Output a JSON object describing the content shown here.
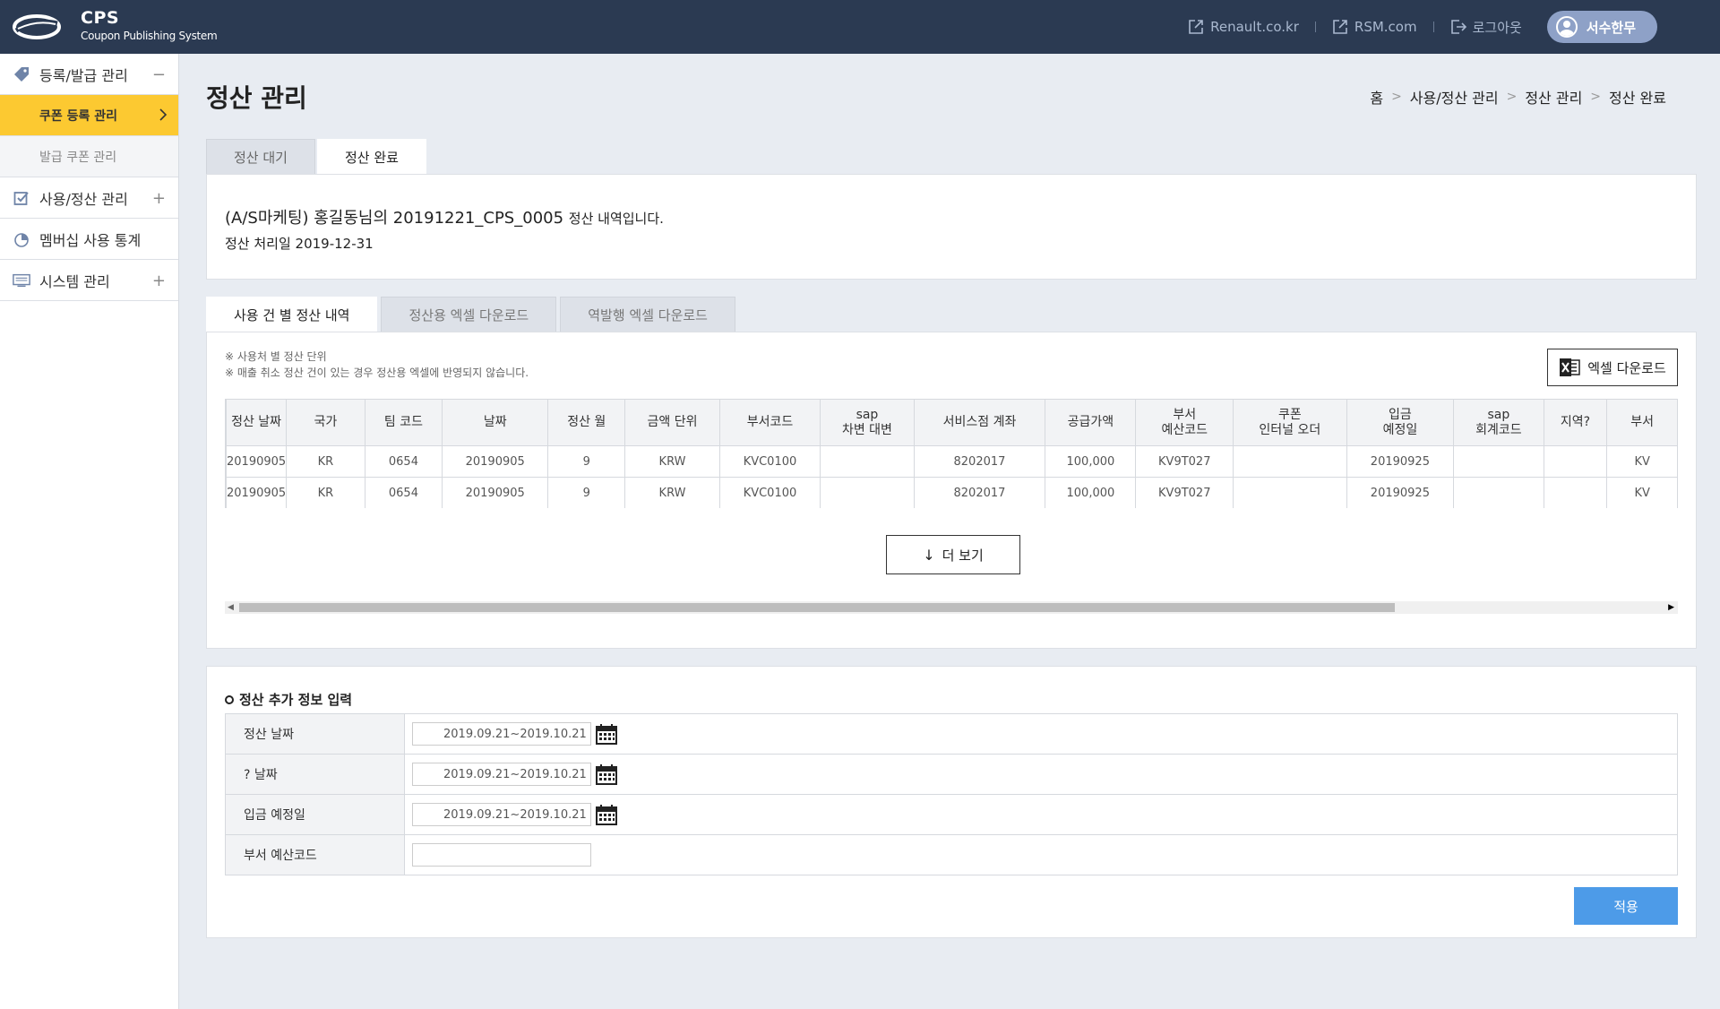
{
  "header": {
    "brand_title": "CPS",
    "brand_subtitle": "Coupon Publishing System",
    "links": [
      "Renault.co.kr",
      "RSM.com",
      "로그아웃"
    ],
    "user_name": "서수한무"
  },
  "sidebar": {
    "groups": [
      {
        "label": "등록/발급 관리",
        "toggle": "−",
        "icon": "tag-icon"
      },
      {
        "label": "사용/정산 관리",
        "toggle": "+",
        "icon": "checkbox-icon"
      },
      {
        "label": "멤버십 사용 통계",
        "toggle": "",
        "icon": "pie-chart-icon"
      },
      {
        "label": "시스템 관리",
        "toggle": "+",
        "icon": "monitor-icon"
      }
    ],
    "sub_items": [
      "쿠폰 등록 관리",
      "발급 쿠폰 관리"
    ]
  },
  "page": {
    "title": "정산 관리",
    "breadcrumb": [
      "홈",
      "사용/정산 관리",
      "정산 관리",
      "정산 완료"
    ]
  },
  "top_tabs": [
    "정산 대기",
    "정산 완료"
  ],
  "info": {
    "headline": "(A/S마케팅) 홍길동님의 20191221_CPS_0005",
    "headline_suffix": "정산 내역입니다.",
    "date_line": "정산 처리일 2019-12-31"
  },
  "sub_tabs": [
    "사용 건 별 정산 내역",
    "정산용 엑셀 다운로드",
    "역발행 엑셀 다운로드"
  ],
  "notes": [
    "※ 사용처 별 정산 단위",
    "※ 매출 취소 정산 건이 있는 경우 정산용 엑셀에 반영되지 않습니다."
  ],
  "excel_button": "엑셀 다운로드",
  "table": {
    "headers": [
      [
        "정산 날짜"
      ],
      [
        "국가"
      ],
      [
        "팀 코드"
      ],
      [
        "날짜"
      ],
      [
        "정산 월"
      ],
      [
        "금액 단위"
      ],
      [
        "부서코드"
      ],
      [
        "sap",
        "차변 대변"
      ],
      [
        "서비스점 계좌"
      ],
      [
        "공급가액"
      ],
      [
        "부서",
        "예산코드"
      ],
      [
        "쿠폰",
        "인터널 오더"
      ],
      [
        "입금",
        "예정일"
      ],
      [
        "sap",
        "회계코드"
      ],
      [
        "지역?"
      ],
      [
        "부서"
      ]
    ],
    "rows": [
      [
        "20190905",
        "KR",
        "0654",
        "20190905",
        "9",
        "KRW",
        "KVC0100",
        "",
        "8202017",
        "100,000",
        "KV9T027",
        "",
        "20190925",
        "",
        "",
        "KV"
      ],
      [
        "20190905",
        "KR",
        "0654",
        "20190905",
        "9",
        "KRW",
        "KVC0100",
        "",
        "8202017",
        "100,000",
        "KV9T027",
        "",
        "20190925",
        "",
        "",
        "KV"
      ]
    ]
  },
  "more_button": "더 보기",
  "form": {
    "title": "정산 추가 정보 입력",
    "rows": [
      {
        "label": "정산 날짜",
        "value": "2019.09.21~2019.10.21",
        "has_calendar": true
      },
      {
        "label": "? 날짜",
        "value": "2019.09.21~2019.10.21",
        "has_calendar": true
      },
      {
        "label": "입금 예정일",
        "value": "2019.09.21~2019.10.21",
        "has_calendar": true
      },
      {
        "label": "부서 예산코드",
        "value": "",
        "has_calendar": false
      }
    ],
    "apply_button": "적용"
  },
  "colors": {
    "header_bg": "#2b3a52",
    "active_menu": "#fcc931",
    "apply_button": "#4d9be8",
    "user_button": "#8ea1c7"
  }
}
